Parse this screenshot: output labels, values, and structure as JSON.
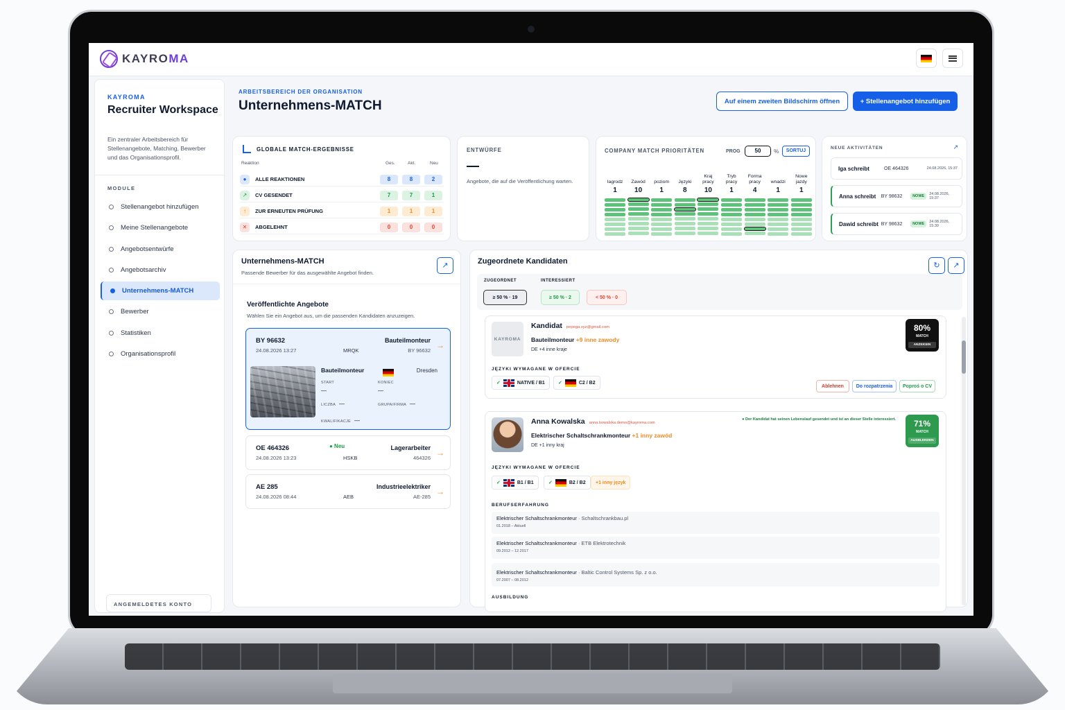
{
  "brand": {
    "name": "KAYROMA"
  },
  "sidebar": {
    "brand": "KAYROMA",
    "title": "Recruiter Workspace",
    "description": "Ein zentraler Arbeitsbereich für Stellenangebote, Matching, Bewerber und das Organisationsprofil.",
    "section": "MODULE",
    "items": [
      {
        "label": "Stellenangebot hinzufügen"
      },
      {
        "label": "Meine Stellenangebote"
      },
      {
        "label": "Angebotsentwürfe"
      },
      {
        "label": "Angebotsarchiv"
      },
      {
        "label": "Unternehmens-MATCH",
        "active": true
      },
      {
        "label": "Bewerber"
      },
      {
        "label": "Statistiken"
      },
      {
        "label": "Organisationsprofil"
      }
    ],
    "account": "ANGEMELDETES KONTO"
  },
  "header": {
    "eyebrow": "ARBEITSBEREICH DER ORGANISATION",
    "title": "Unternehmens-MATCH",
    "second_screen_label": "Auf einem zweiten Bildschirm öffnen",
    "add_offer_label": "+ Stellenangebot hinzufügen"
  },
  "global_match": {
    "title": "GLOBALE MATCH-ERGEBNISSE",
    "columns": [
      "Reaktion",
      "Ges.",
      "Akt.",
      "Neu"
    ],
    "rows": [
      {
        "label": "ALLE REAKTIONEN",
        "icon": "dot-icon",
        "total": "8",
        "active": "8",
        "new": "2",
        "color": "#1560e6"
      },
      {
        "label": "CV GESENDET",
        "icon": "send-icon",
        "total": "7",
        "active": "7",
        "new": "1",
        "color": "#1d9a47"
      },
      {
        "label": "ZUR ERNEUTEN PRÜFUNG",
        "icon": "arrow-up-icon",
        "total": "1",
        "active": "1",
        "new": "1",
        "color": "#f08a24"
      },
      {
        "label": "ABGELEHNT",
        "icon": "close-icon",
        "total": "0",
        "active": "0",
        "new": "0",
        "color": "#e0402e"
      }
    ]
  },
  "drafts": {
    "title": "ENTWÜRFE",
    "value": "—",
    "description": "Angebote, die auf die Veröffentlichung warten."
  },
  "priorities": {
    "title": "COMPANY MATCH PRIORITÄTEN",
    "prog_label": "PROG",
    "prog_value": "50",
    "pct": "%",
    "sort_label": "SORTUJ",
    "columns": [
      {
        "name": "Iagrodz",
        "value": "1",
        "bars": 8,
        "selected": -1
      },
      {
        "name": "Zawód",
        "value": "10",
        "bars": 8,
        "selected": 0
      },
      {
        "name": "poziom",
        "value": "1",
        "bars": 8,
        "selected": -1
      },
      {
        "name": "Języki",
        "value": "8",
        "bars": 8,
        "selected": 2
      },
      {
        "name": "Kraj pracy",
        "value": "10",
        "bars": 8,
        "selected": 0
      },
      {
        "name": "Tryb pracy",
        "value": "1",
        "bars": 8,
        "selected": -1
      },
      {
        "name": "Forma pracy",
        "value": "4",
        "bars": 8,
        "selected": 6
      },
      {
        "name": "wnadzi",
        "value": "1",
        "bars": 8,
        "selected": -1
      },
      {
        "name": "Nowe jazdy",
        "value": "1",
        "bars": 8,
        "selected": -1
      }
    ]
  },
  "activities": {
    "title": "NEUE AKTIVITÄTEN",
    "items": [
      {
        "who": "Iga schreibt",
        "ref": "OE 464326",
        "badge": "",
        "time": "24.08.2026, 15:37"
      },
      {
        "who": "Anna schreibt",
        "ref": "BY 98632",
        "badge": "NOWE",
        "time": "24.08.2026, 15:37"
      },
      {
        "who": "Dawid schreibt",
        "ref": "BY 98632",
        "badge": "NOWE",
        "time": "24.08.2026, 15:30"
      }
    ]
  },
  "match_panel": {
    "title": "Unternehmens-MATCH",
    "subtitle": "Passende Bewerber für das ausgewählte Angebot finden.",
    "published_title": "Veröffentlichte Angebote",
    "published_desc": "Wählen Sie ein Angebot aus, um die passenden Kandidaten anzuzeigen.",
    "offers": [
      {
        "id": "BY 96632",
        "date": "24.08.2026 13:27",
        "code": "MRQK",
        "role": "Bauteilmonteur",
        "ref": "BY 96632",
        "detail": {
          "role": "Bauteilmonteur",
          "city": "Dresden",
          "start_label": "START",
          "start": "—",
          "end_label": "KONIEC",
          "end": "—",
          "count_label": "LICZBA",
          "count": "—",
          "group_label": "GRUPA/FIRMA",
          "group": "—",
          "qual_label": "KWALIFIKACJE",
          "qual": "—"
        }
      },
      {
        "id": "OE 464326",
        "date": "24.08.2026 13:23",
        "code": "HSKB",
        "badge": "● Neu",
        "role": "Lagerarbeiter",
        "ref": "464326"
      },
      {
        "id": "AE 285",
        "date": "24.08.2026 08:44",
        "code": "AEB",
        "role": "Industrieelektriker",
        "ref": "AE-285"
      }
    ]
  },
  "candidates": {
    "title": "Zugeordnete Kandidaten",
    "filter_assigned": "ZUGEORDNET",
    "filter_interested": "INTERESSIERT",
    "pills": [
      "≥ 50 % · 19",
      "≥ 50 % · 2",
      "< 50 % · 0"
    ],
    "list": [
      {
        "name": "Kandidat",
        "email": "pepega.xyz@gmail.com",
        "avatar_text": "KAYROMA",
        "role": "Bauteilmonteur",
        "role_more": "+9 inne zawody",
        "location": "DE +4 inne kraje",
        "score": "80%",
        "score_label": "MATCH",
        "score_button": "ANZEIGEN",
        "score_color": "#111111",
        "lang_title": "JĘZYKI WYMAGANE W OFERCIE",
        "langs": [
          {
            "text": "NATIVE / B1",
            "flag": "uk"
          },
          {
            "text": "C2 / B2",
            "flag": "de"
          }
        ],
        "actions": [
          "Ablehnen",
          "Do rozpatrzenia",
          "Poproś o CV"
        ]
      },
      {
        "name": "Anna Kowalska",
        "email": "anna.kowalska.demo@kayroma.com",
        "role": "Elektrischer Schaltschrankmonteur",
        "role_more": "+1 inny zawód",
        "location": "DE +1 inny kraj",
        "note": "● Der Kandidat hat seinen Lebenslauf gesendet und ist an dieser Stelle interessiert.",
        "score": "71%",
        "score_label": "MATCH",
        "score_button": "AUSBLENDEN",
        "score_color": "#2e9a4e",
        "lang_title": "JĘZYKI WYMAGANE W OFERCIE",
        "langs": [
          {
            "text": "B1 / B1",
            "flag": "uk"
          },
          {
            "text": "B2 / B2",
            "flag": "de"
          }
        ],
        "lang_more": "+1 inny język",
        "experience_title": "BERUFSERFAHRUNG",
        "experience": [
          {
            "title": "Elektrischer Schaltschrankmonteur",
            "company": " · Schaltschrankbau.pl",
            "dates": "01.2018 – Aktuell"
          },
          {
            "title": "Elektrischer Schaltschrankmonteur",
            "company": " · ETB Elektrotechnik",
            "dates": "09.2012 – 12.2017"
          },
          {
            "title": "Elektrischer Schaltschrankmonteur",
            "company": " · Baltic Control Systems Sp. z o.o.",
            "dates": "07.2007 – 08.2012"
          }
        ],
        "education_title": "AUSBILDUNG"
      }
    ]
  }
}
